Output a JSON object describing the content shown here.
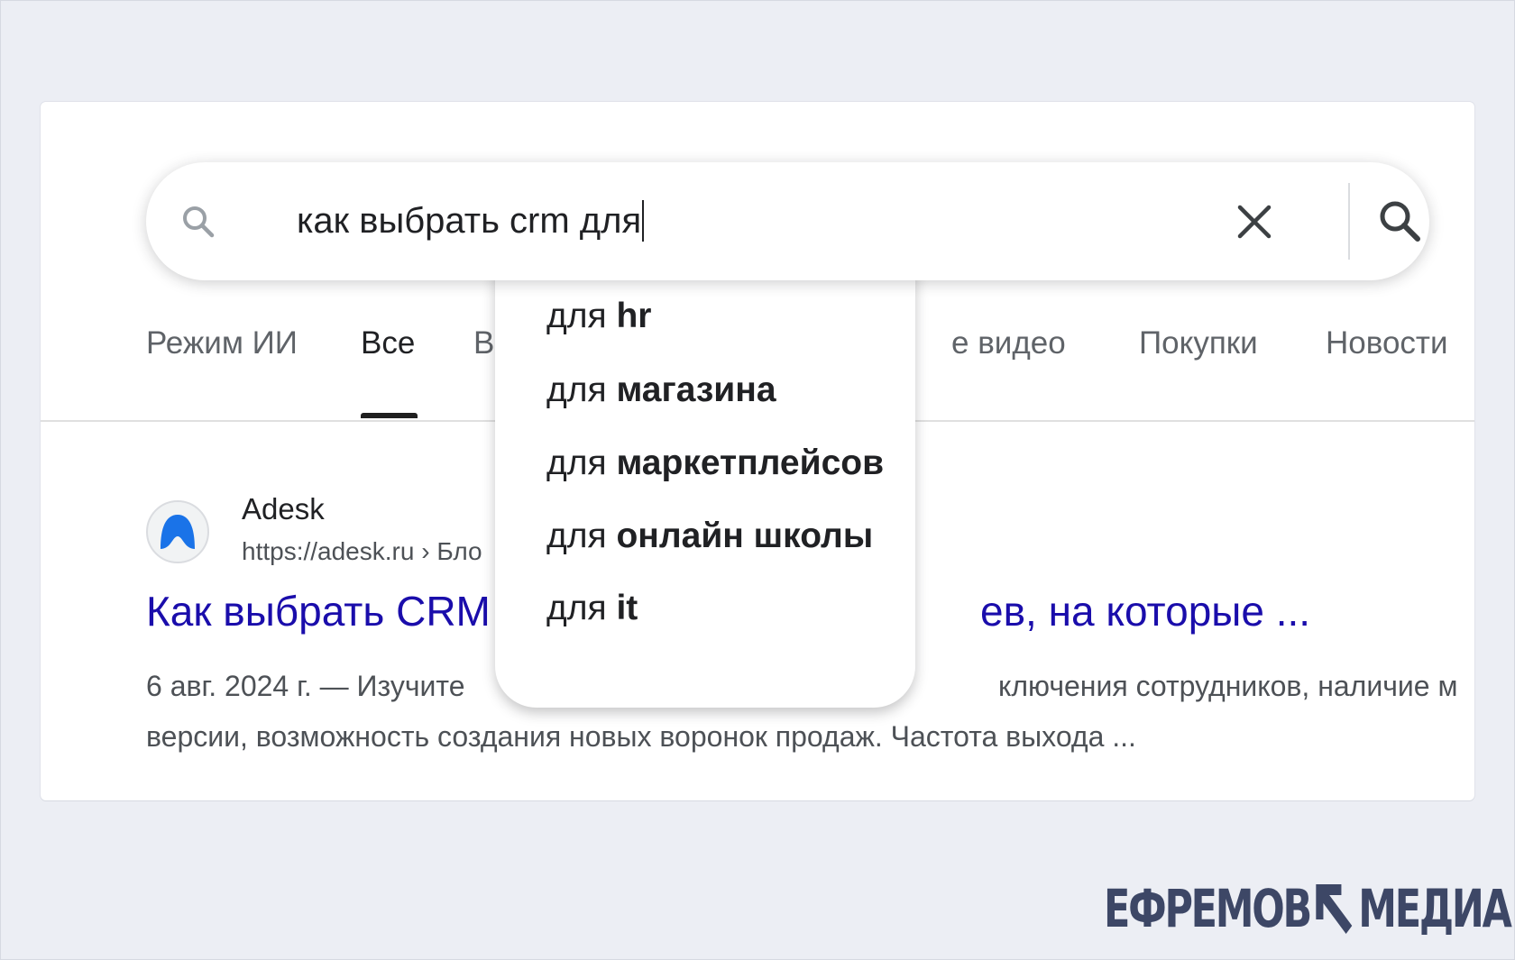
{
  "search": {
    "query": "как выбрать crm для",
    "clear_label": "Clear",
    "search_label": "Search"
  },
  "suggestions": [
    {
      "prefix": "для ",
      "completion": "hr"
    },
    {
      "prefix": "для ",
      "completion": "магазина"
    },
    {
      "prefix": "для ",
      "completion": "маркетплейсов"
    },
    {
      "prefix": "для ",
      "completion": "онлайн школы"
    },
    {
      "prefix": "для ",
      "completion": "it"
    }
  ],
  "tabs": [
    {
      "label": "Режим ИИ"
    },
    {
      "label": "Все"
    },
    {
      "label": "В"
    },
    {
      "label": "е видео"
    },
    {
      "label": "Покупки"
    },
    {
      "label": "Новости"
    }
  ],
  "result": {
    "site_name": "Adesk",
    "url": "https://adesk.ru › Бло",
    "title_left": "Как выбрать CRM",
    "title_right": "ев, на которые ...",
    "snippet_date": "6 авг. 2024 г.",
    "snippet_line1_left": " — Изучите",
    "snippet_line1_right": "ключения сотрудников, наличие м",
    "snippet_line2": "версии, возможность создания новых воронок продаж. Частота выхода ..."
  },
  "logo": {
    "left_text": "ЕФРЕМОВ",
    "right_text": "МЕДИА",
    "color": "#3d4766"
  },
  "colors": {
    "link": "#1a0dab",
    "page_bg": "#eceef4",
    "favicon_blue": "#1a73e8"
  }
}
